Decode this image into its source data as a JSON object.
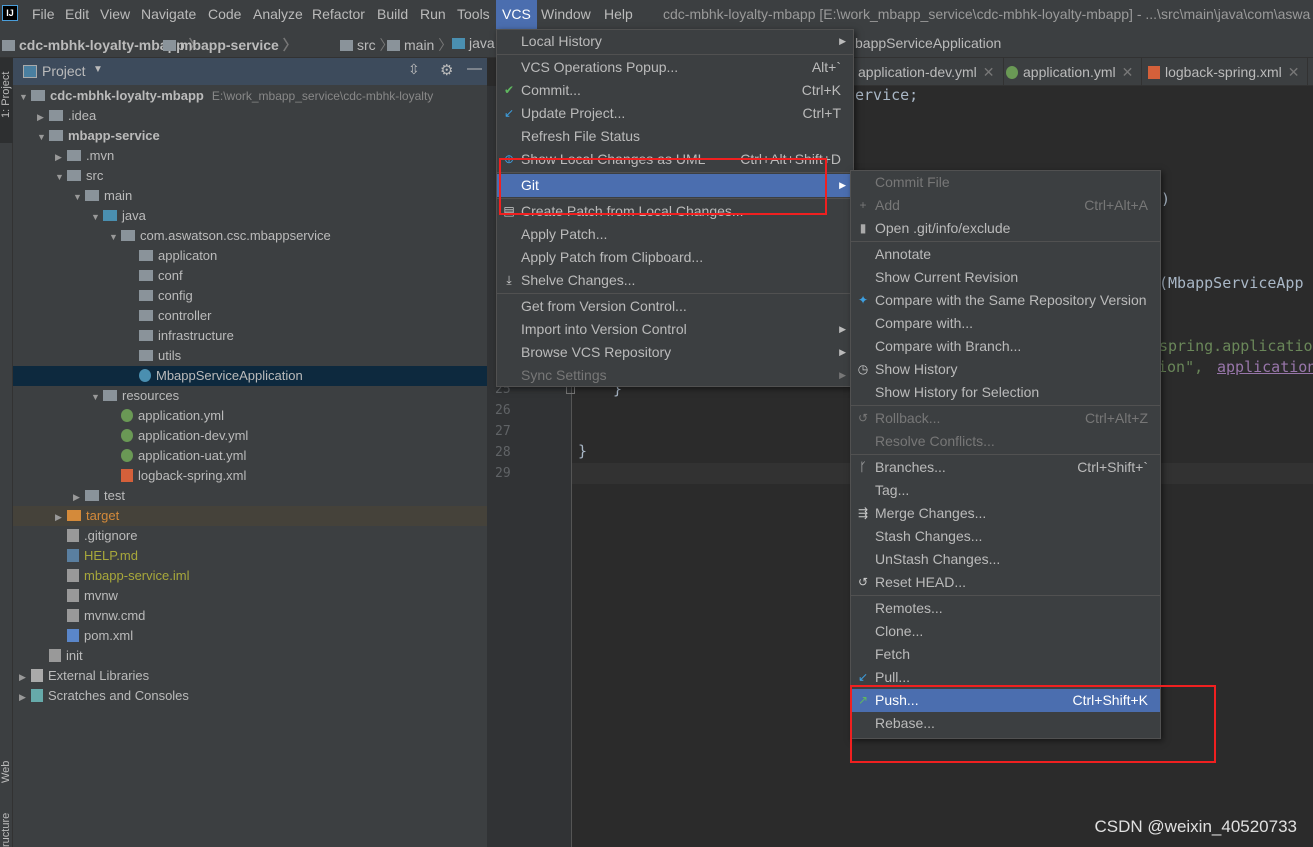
{
  "menubar": {
    "items": [
      "File",
      "Edit",
      "View",
      "Navigate",
      "Code",
      "Analyze",
      "Refactor",
      "Build",
      "Run",
      "Tools",
      "VCS",
      "Window",
      "Help"
    ],
    "active": "VCS"
  },
  "window_title": "cdc-mbhk-loyalty-mbapp [E:\\work_mbapp_service\\cdc-mbhk-loyalty-mbapp] - ...\\src\\main\\java\\com\\aswa",
  "breadcrumb": [
    "cdc-mbhk-loyalty-mbapp",
    "mbapp-service",
    "src",
    "main",
    "java"
  ],
  "breadcrumb_tail": "bappServiceApplication",
  "left_strip": {
    "top": "1: Project",
    "web": "Web",
    "structure": "ructure"
  },
  "project_panel": {
    "title": "Project",
    "tree": [
      {
        "label": "cdc-mbhk-loyalty-mbapp",
        "hint": "E:\\work_mbapp_service\\cdc-mbhk-loyalty",
        "depth": 0,
        "arrow": "open",
        "bold": true,
        "icon": "module"
      },
      {
        "label": ".idea",
        "depth": 1,
        "arrow": "closed",
        "icon": "folder"
      },
      {
        "label": "mbapp-service",
        "depth": 1,
        "arrow": "open",
        "bold": true,
        "icon": "module"
      },
      {
        "label": ".mvn",
        "depth": 2,
        "arrow": "closed",
        "icon": "folder"
      },
      {
        "label": "src",
        "depth": 2,
        "arrow": "open",
        "icon": "folder"
      },
      {
        "label": "main",
        "depth": 3,
        "arrow": "open",
        "icon": "folder"
      },
      {
        "label": "java",
        "depth": 4,
        "arrow": "open",
        "icon": "source-folder"
      },
      {
        "label": "com.aswatson.csc.mbappservice",
        "depth": 5,
        "arrow": "open",
        "icon": "package"
      },
      {
        "label": "applicaton",
        "depth": 6,
        "icon": "package"
      },
      {
        "label": "conf",
        "depth": 6,
        "icon": "package"
      },
      {
        "label": "config",
        "depth": 6,
        "icon": "package"
      },
      {
        "label": "controller",
        "depth": 6,
        "icon": "package"
      },
      {
        "label": "infrastructure",
        "depth": 6,
        "icon": "package"
      },
      {
        "label": "utils",
        "depth": 6,
        "icon": "package"
      },
      {
        "label": "MbappServiceApplication",
        "depth": 6,
        "icon": "spring-class",
        "selected": true
      },
      {
        "label": "resources",
        "depth": 4,
        "arrow": "open",
        "icon": "resources-folder"
      },
      {
        "label": "application.yml",
        "depth": 5,
        "icon": "spring-yml"
      },
      {
        "label": "application-dev.yml",
        "depth": 5,
        "icon": "spring-yml"
      },
      {
        "label": "application-uat.yml",
        "depth": 5,
        "icon": "spring-yml"
      },
      {
        "label": "logback-spring.xml",
        "depth": 5,
        "icon": "xml"
      },
      {
        "label": "test",
        "depth": 3,
        "arrow": "closed",
        "icon": "folder"
      },
      {
        "label": "target",
        "depth": 2,
        "arrow": "closed",
        "icon": "excluded-folder",
        "excluded": true
      },
      {
        "label": ".gitignore",
        "depth": 2,
        "icon": "file"
      },
      {
        "label": "HELP.md",
        "depth": 2,
        "icon": "md",
        "color": "#a8a83b"
      },
      {
        "label": "mbapp-service.iml",
        "depth": 2,
        "icon": "iml",
        "color": "#a8a83b"
      },
      {
        "label": "mvnw",
        "depth": 2,
        "icon": "file"
      },
      {
        "label": "mvnw.cmd",
        "depth": 2,
        "icon": "file"
      },
      {
        "label": "pom.xml",
        "depth": 2,
        "icon": "maven"
      },
      {
        "label": "init",
        "depth": 1,
        "icon": "file"
      },
      {
        "label": "External Libraries",
        "depth": 0,
        "arrow": "closed",
        "icon": "libraries"
      },
      {
        "label": "Scratches and Consoles",
        "depth": 0,
        "arrow": "closed",
        "icon": "scratches"
      }
    ]
  },
  "tabs": [
    {
      "label": "application-dev.yml"
    },
    {
      "label": "application.yml"
    },
    {
      "label": "logback-spring.xml"
    }
  ],
  "editor": {
    "line_numbers": [
      "25",
      "26",
      "27",
      "28",
      "29"
    ],
    "code": [
      {
        "text": "ervice;",
        "color": "#a9b7c6"
      },
      {
        "text": "ss",
        "color": "#cc7832"
      },
      {
        "text": "})",
        "color": "#a9b7c6"
      },
      {
        "text": "un",
        "color": "#a9b7c6"
      },
      {
        "text": "(MbappServiceApp",
        "color": "#a9b7c6"
      },
      {
        "text": "spring.application",
        "color": "#6a8759"
      },
      {
        "text": "ion\", ",
        "color": "#6a8759"
      },
      {
        "text": "application",
        "color": "#9876aa"
      },
      {
        "text": "}",
        "color": "#a9b7c6"
      },
      {
        "text": "}",
        "color": "#a9b7c6"
      }
    ]
  },
  "vcs_menu": [
    {
      "label": "Local History",
      "submenu": true
    },
    {
      "sep": true
    },
    {
      "label": "VCS Operations Popup...",
      "shortcut": "Alt+`"
    },
    {
      "label": "Commit...",
      "shortcut": "Ctrl+K",
      "icon": "check-icon"
    },
    {
      "label": "Update Project...",
      "shortcut": "Ctrl+T",
      "icon": "update-icon"
    },
    {
      "label": "Refresh File Status"
    },
    {
      "label": "Show Local Changes as UML",
      "shortcut": "Ctrl+Alt+Shift+D",
      "icon": "uml-icon"
    },
    {
      "sep": true
    },
    {
      "label": "Git",
      "submenu": true,
      "highlighted": true
    },
    {
      "sep": true
    },
    {
      "label": "Create Patch from Local Changes...",
      "icon": "patch-icon"
    },
    {
      "label": "Apply Patch..."
    },
    {
      "label": "Apply Patch from Clipboard..."
    },
    {
      "label": "Shelve Changes...",
      "icon": "shelve-icon"
    },
    {
      "sep": true
    },
    {
      "label": "Get from Version Control..."
    },
    {
      "label": "Import into Version Control",
      "submenu": true
    },
    {
      "label": "Browse VCS Repository",
      "submenu": true
    },
    {
      "label": "Sync Settings",
      "submenu": true,
      "disabled": true
    }
  ],
  "git_menu": [
    {
      "label": "Commit File",
      "disabled": true
    },
    {
      "label": "Add",
      "shortcut": "Ctrl+Alt+A",
      "disabled": true,
      "icon": "plus-icon"
    },
    {
      "label": "Open .git/info/exclude",
      "icon": "file-exclude-icon"
    },
    {
      "sep": true
    },
    {
      "label": "Annotate"
    },
    {
      "label": "Show Current Revision"
    },
    {
      "label": "Compare with the Same Repository Version",
      "icon": "compare-icon"
    },
    {
      "label": "Compare with..."
    },
    {
      "label": "Compare with Branch..."
    },
    {
      "label": "Show History",
      "icon": "clock-icon"
    },
    {
      "label": "Show History for Selection"
    },
    {
      "sep": true
    },
    {
      "label": "Rollback...",
      "shortcut": "Ctrl+Alt+Z",
      "disabled": true,
      "icon": "rollback-icon"
    },
    {
      "label": "Resolve Conflicts...",
      "disabled": true
    },
    {
      "sep": true
    },
    {
      "label": "Branches...",
      "shortcut": "Ctrl+Shift+`",
      "icon": "branch-icon"
    },
    {
      "label": "Tag..."
    },
    {
      "label": "Merge Changes...",
      "icon": "merge-icon"
    },
    {
      "label": "Stash Changes..."
    },
    {
      "label": "UnStash Changes..."
    },
    {
      "label": "Reset HEAD...",
      "icon": "reset-icon"
    },
    {
      "sep": true
    },
    {
      "label": "Remotes..."
    },
    {
      "label": "Clone..."
    },
    {
      "label": "Fetch"
    },
    {
      "label": "Pull...",
      "icon": "pull-icon"
    },
    {
      "label": "Push...",
      "shortcut": "Ctrl+Shift+K",
      "highlighted": true,
      "icon": "push-icon"
    },
    {
      "label": "Rebase..."
    }
  ],
  "colors": {
    "menu_bg": "#3c3f41",
    "highlight": "#4b6eaf",
    "annotation_red": "#f02020",
    "selection": "#0d293e"
  },
  "watermark": "CSDN @weixin_40520733"
}
